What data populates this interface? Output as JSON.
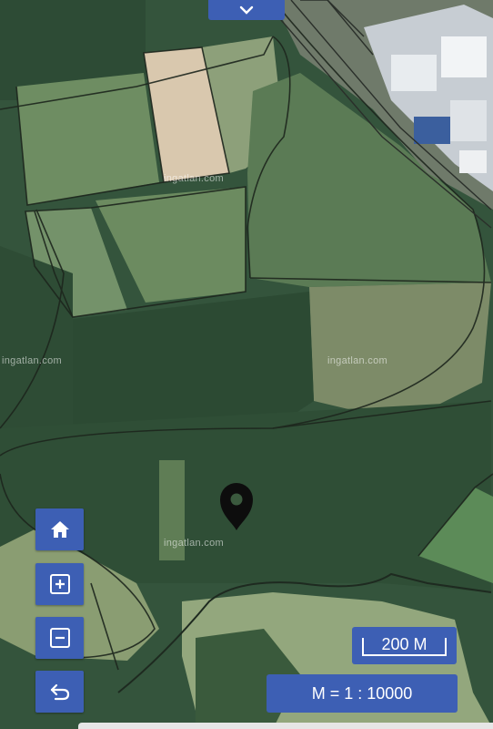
{
  "watermarks": [
    "ingatlan.com",
    "ingatlan.com",
    "ingatlan.com",
    "ingatlan.com"
  ],
  "scale": {
    "bar_label": "200 M",
    "ratio_label": "M = 1 : 10000"
  },
  "controls": [
    {
      "name": "home-button",
      "icon": "home-icon"
    },
    {
      "name": "zoom-in-button",
      "icon": "plus-square-icon"
    },
    {
      "name": "zoom-out-button",
      "icon": "minus-square-icon"
    },
    {
      "name": "back-button",
      "icon": "undo-arrow-icon"
    }
  ],
  "top_toggle_icon": "chevron-down-icon",
  "marker_icon": "map-pin-icon",
  "colors": {
    "control_blue": "#3d5fb4",
    "forest": "#2f4f37",
    "field": "#7c9a6e",
    "bare_field": "#d8c9b0"
  }
}
